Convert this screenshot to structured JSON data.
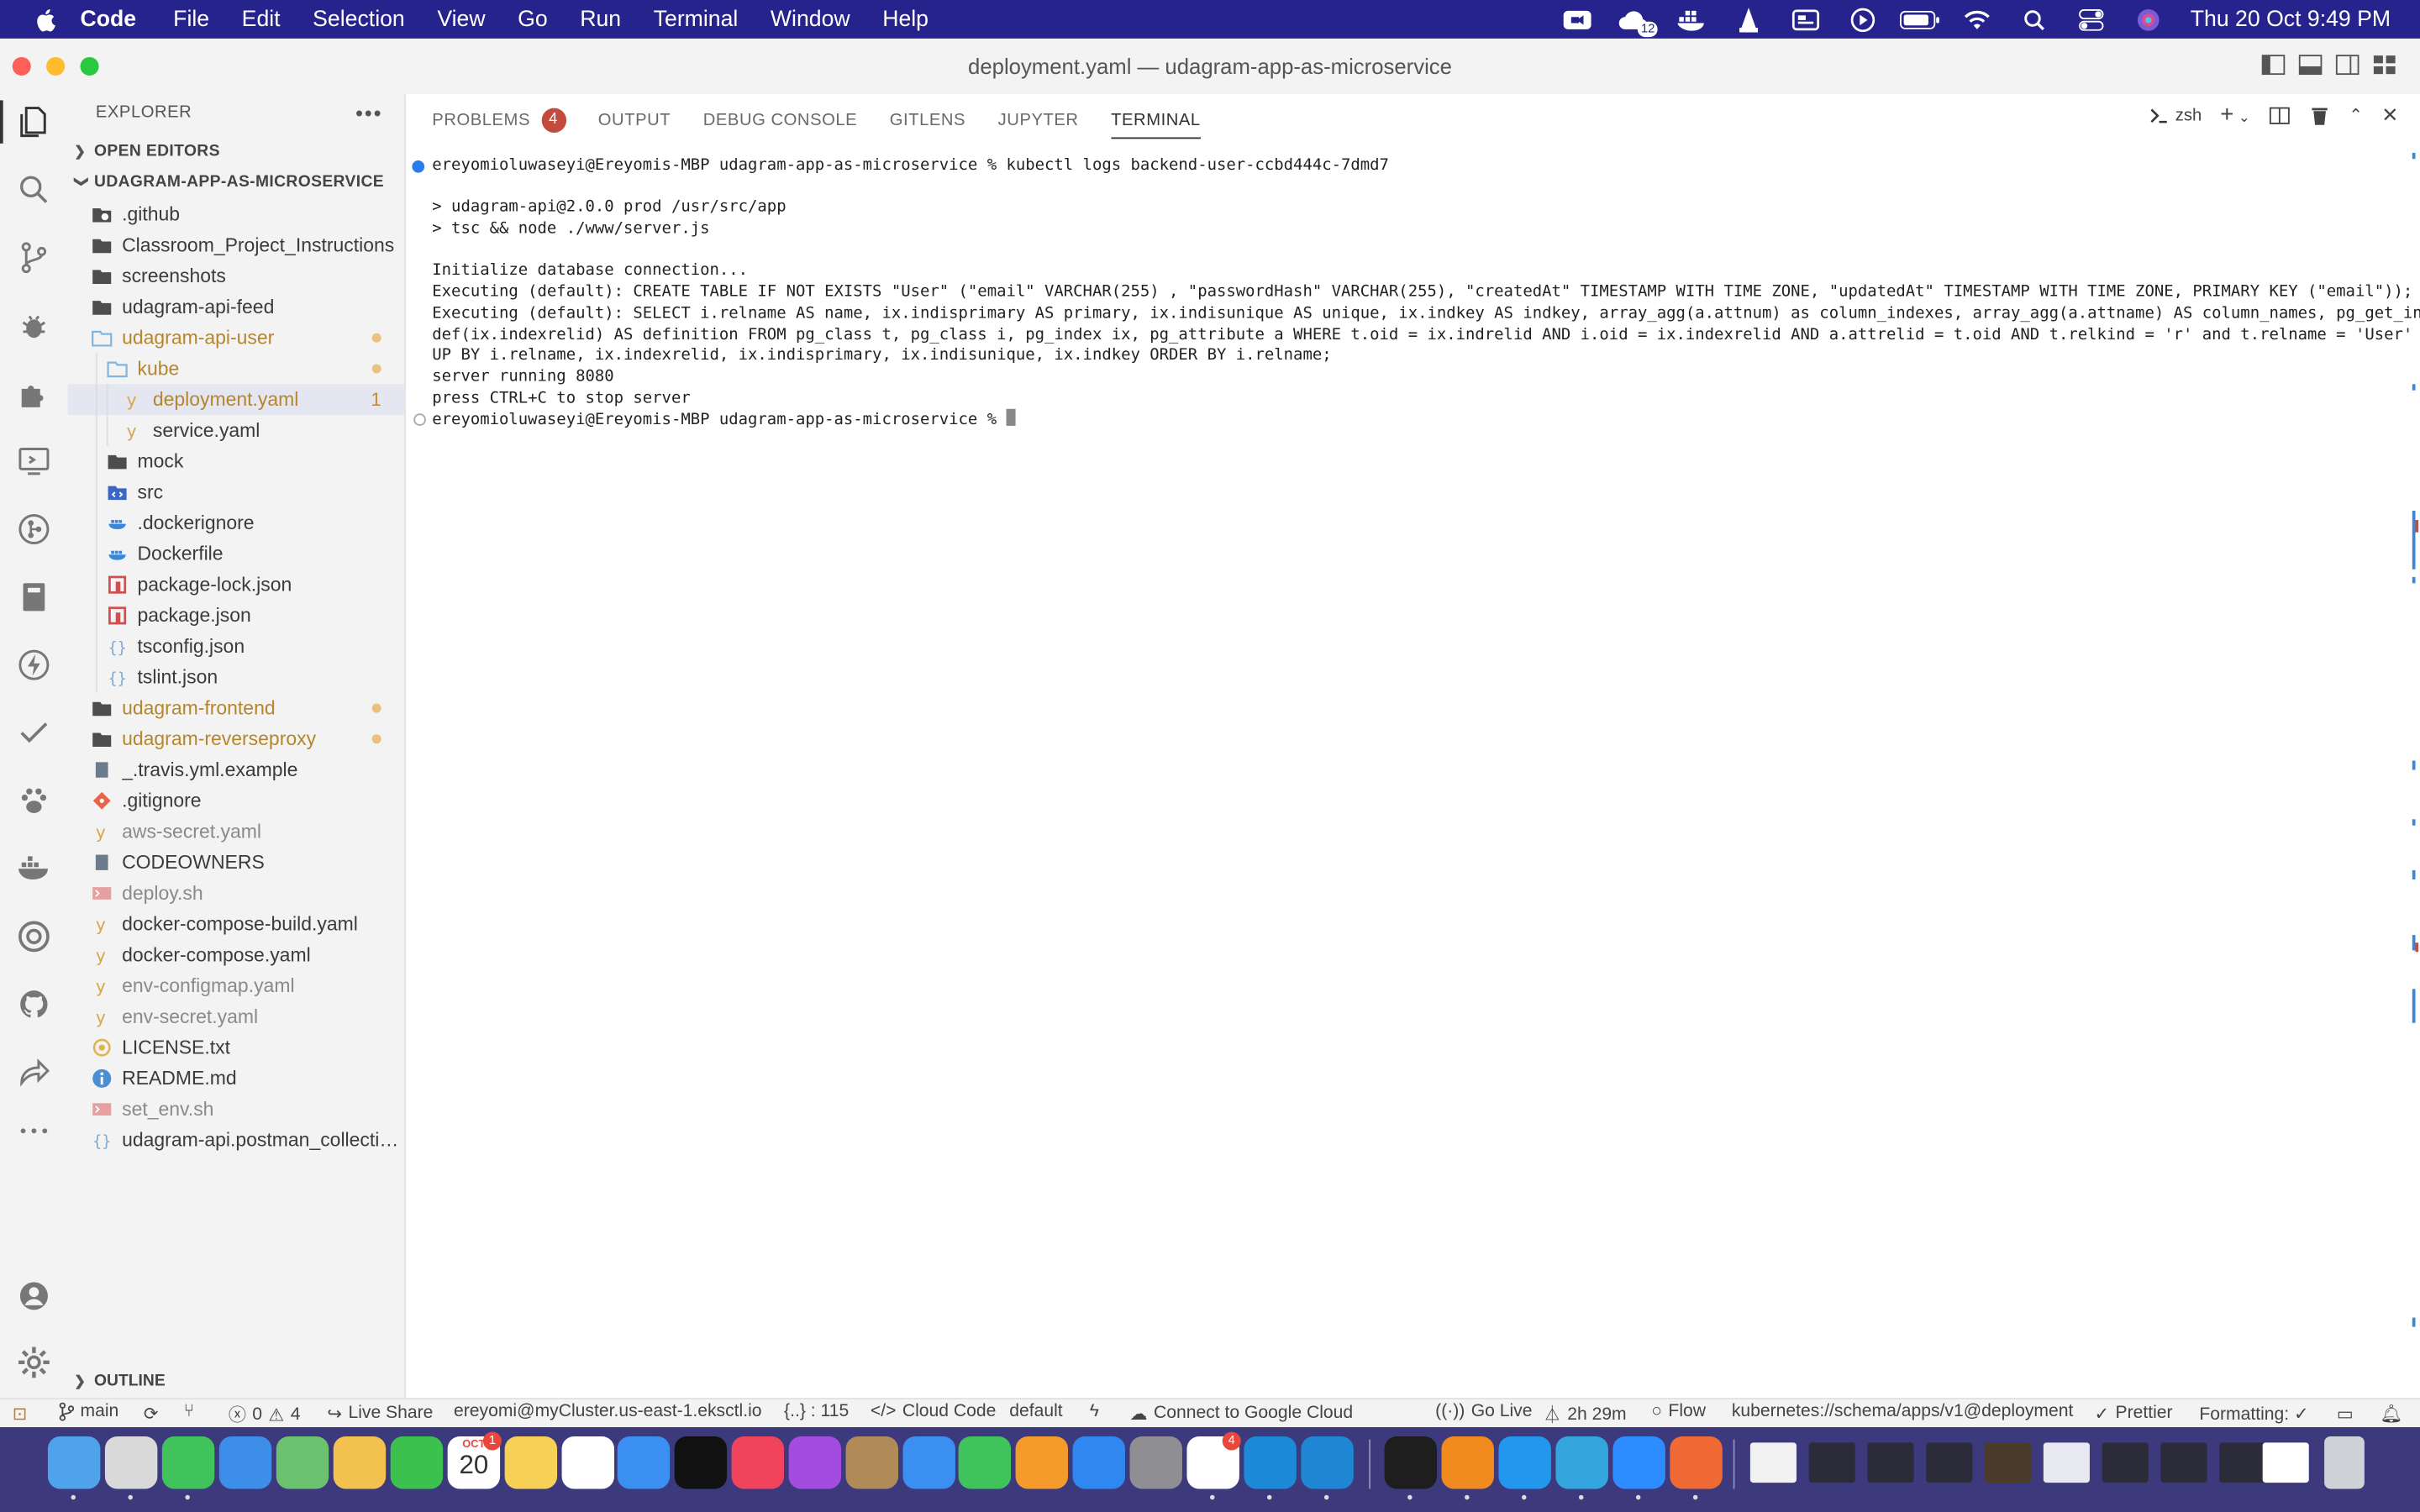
{
  "menubar": {
    "app": "Code",
    "items": [
      "File",
      "Edit",
      "Selection",
      "View",
      "Go",
      "Run",
      "Terminal",
      "Window",
      "Help"
    ],
    "notification_count": "12",
    "clock": "Thu 20 Oct  9:49 PM"
  },
  "window": {
    "title": "deployment.yaml — udagram-app-as-microservice"
  },
  "explorer": {
    "header": "EXPLORER",
    "open_editors": "OPEN EDITORS",
    "project": "UDAGRAM-APP-AS-MICROSERVICE",
    "outline": "OUTLINE",
    "deployment_problems": "1",
    "files": [
      {
        "name": ".github"
      },
      {
        "name": "Classroom_Project_Instructions"
      },
      {
        "name": "screenshots"
      },
      {
        "name": "udagram-api-feed"
      },
      {
        "name": "udagram-api-user"
      },
      {
        "name": "kube"
      },
      {
        "name": "deployment.yaml"
      },
      {
        "name": "service.yaml"
      },
      {
        "name": "mock"
      },
      {
        "name": "src"
      },
      {
        "name": ".dockerignore"
      },
      {
        "name": "Dockerfile"
      },
      {
        "name": "package-lock.json"
      },
      {
        "name": "package.json"
      },
      {
        "name": "tsconfig.json"
      },
      {
        "name": "tslint.json"
      },
      {
        "name": "udagram-frontend"
      },
      {
        "name": "udagram-reverseproxy"
      },
      {
        "name": "_.travis.yml.example"
      },
      {
        "name": ".gitignore"
      },
      {
        "name": "aws-secret.yaml"
      },
      {
        "name": "CODEOWNERS"
      },
      {
        "name": "deploy.sh"
      },
      {
        "name": "docker-compose-build.yaml"
      },
      {
        "name": "docker-compose.yaml"
      },
      {
        "name": "env-configmap.yaml"
      },
      {
        "name": "env-secret.yaml"
      },
      {
        "name": "LICENSE.txt"
      },
      {
        "name": "README.md"
      },
      {
        "name": "set_env.sh"
      },
      {
        "name": "udagram-api.postman_collectio..."
      }
    ]
  },
  "panel": {
    "tabs": [
      {
        "label": "PROBLEMS",
        "badge": "4"
      },
      {
        "label": "OUTPUT"
      },
      {
        "label": "DEBUG CONSOLE"
      },
      {
        "label": "GITLENS"
      },
      {
        "label": "JUPYTER"
      },
      {
        "label": "TERMINAL"
      }
    ],
    "shell": "zsh",
    "terminal_lines": [
      "ereyomioluwaseyi@Ereyomis-MBP udagram-app-as-microservice % kubectl logs backend-user-ccbd444c-7dmd7",
      "",
      "> udagram-api@2.0.0 prod /usr/src/app",
      "> tsc && node ./www/server.js",
      "",
      "Initialize database connection...",
      "Executing (default): CREATE TABLE IF NOT EXISTS \"User\" (\"email\" VARCHAR(255) , \"passwordHash\" VARCHAR(255), \"createdAt\" TIMESTAMP WITH TIME ZONE, \"updatedAt\" TIMESTAMP WITH TIME ZONE, PRIMARY KEY (\"email\"));",
      "Executing (default): SELECT i.relname AS name, ix.indisprimary AS primary, ix.indisunique AS unique, ix.indkey AS indkey, array_agg(a.attnum) as column_indexes, array_agg(a.attname) AS column_names, pg_get_index",
      "def(ix.indexrelid) AS definition FROM pg_class t, pg_class i, pg_index ix, pg_attribute a WHERE t.oid = ix.indrelid AND i.oid = ix.indexrelid AND a.attrelid = t.oid AND t.relkind = 'r' and t.relname = 'User' GRO",
      "UP BY i.relname, ix.indexrelid, ix.indisprimary, ix.indisunique, ix.indkey ORDER BY i.relname;",
      "server running 8080",
      "press CTRL+C to stop server",
      "ereyomioluwaseyi@Ereyomis-MBP udagram-app-as-microservice % "
    ]
  },
  "statusbar": {
    "branch": "main",
    "errors": "0",
    "warnings": "4",
    "live_share": "Live Share",
    "cluster": "ereyomi@myCluster.us-east-1.eksctl.io",
    "json_path": "{..} : 115",
    "cloud_code": "Cloud Code",
    "namespace": "default",
    "google_cloud": "Connect to Google Cloud",
    "go_live": "Go Live",
    "time": "2h 29m",
    "flow": "Flow",
    "schema": "kubernetes://schema/apps/v1@deployment",
    "prettier": "Prettier",
    "formatting": "Formatting: ✓"
  },
  "dock": {
    "calendar_month": "OCT",
    "calendar_day": "20",
    "calendar_badge": "1",
    "slack_badge": "4"
  }
}
